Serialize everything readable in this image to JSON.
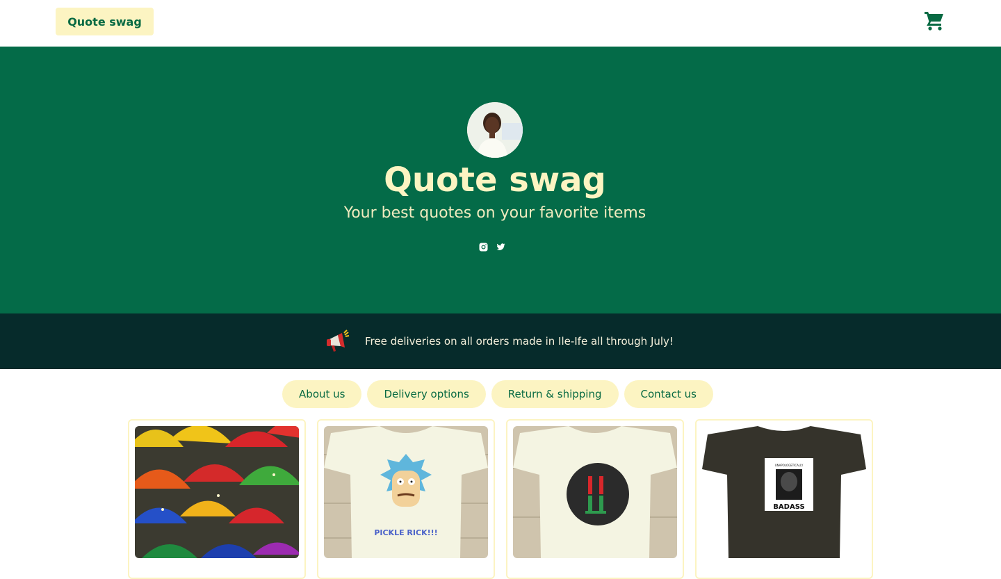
{
  "header": {
    "brand_label": "Quote swag",
    "cart_icon": "cart-icon"
  },
  "hero": {
    "title": "Quote swag",
    "subtitle": "Your best quotes on your favorite items",
    "socials": [
      "instagram-icon",
      "twitter-icon"
    ]
  },
  "announcement": {
    "icon": "megaphone-icon",
    "text": "Free deliveries on all orders made in Ile-Ife all through July!"
  },
  "nav": {
    "items": [
      {
        "label": "About us"
      },
      {
        "label": "Delivery options"
      },
      {
        "label": "Return & shipping"
      },
      {
        "label": "Contact us"
      }
    ]
  },
  "products": [
    {
      "image": "colorful-umbrellas-image",
      "print_text": ""
    },
    {
      "image": "pickle-rick-tshirt-image",
      "print_text": "PICKLE RICK!!!"
    },
    {
      "image": "round-logo-tshirt-image",
      "print_text": ""
    },
    {
      "image": "badass-black-tshirt-image",
      "print_text": "UNAPOLOGETICALLY BADASS"
    }
  ],
  "colors": {
    "primary_green": "#046b48",
    "accent_cream": "#fcf4c2",
    "announcement_bg": "#062b2b"
  }
}
